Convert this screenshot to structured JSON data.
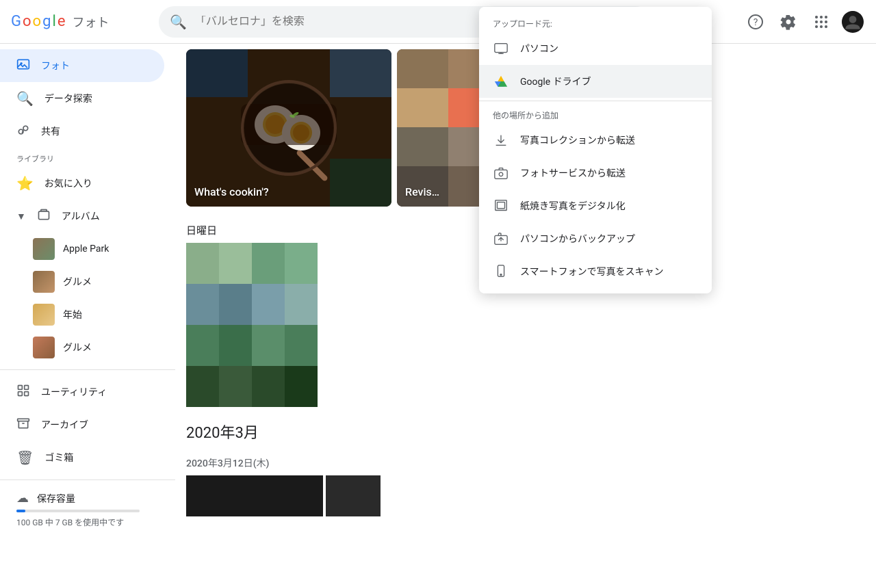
{
  "header": {
    "google_text": "Google",
    "app_name": "フォト",
    "search_placeholder": "「バルセロナ」を検索"
  },
  "sidebar": {
    "photos_label": "フォト",
    "search_label": "データ探索",
    "sharing_label": "共有",
    "library_section": "ライブラリ",
    "favorites_label": "お気に入り",
    "albums_label": "アルバム",
    "albums": [
      {
        "name": "Apple Park",
        "color1": "#8B7355",
        "color2": "#6B8E6B"
      },
      {
        "name": "グルメ",
        "color1": "#8B6B47",
        "color2": "#C4956A"
      },
      {
        "name": "年始",
        "color1": "#D4A853",
        "color2": "#E8C88A"
      },
      {
        "name": "グルメ",
        "color1": "#C47A5A",
        "color2": "#8B5E3C"
      }
    ],
    "utilities_label": "ユーティリティ",
    "archive_label": "アーカイブ",
    "trash_label": "ゴミ箱",
    "storage_label": "保存容量",
    "storage_info": "100 GB 中 7 GB を使用中です",
    "storage_percent": 7
  },
  "dropdown": {
    "upload_section_label": "アップロード元:",
    "items_upload": [
      {
        "id": "pc",
        "label": "パソコン",
        "icon": "💻"
      },
      {
        "id": "google-drive",
        "label": "Google ドライブ",
        "icon": "▲",
        "highlighted": true
      }
    ],
    "other_section_label": "他の場所から追加",
    "items_other": [
      {
        "id": "photo-collection",
        "label": "写真コレクションから転送",
        "icon": "⬇"
      },
      {
        "id": "photo-service",
        "label": "フォトサービスから転送",
        "icon": "📷"
      },
      {
        "id": "print-digitize",
        "label": "紙焼き写真をデジタル化",
        "icon": "🖼"
      },
      {
        "id": "pc-backup",
        "label": "パソコンからバックアップ",
        "icon": "⬆"
      },
      {
        "id": "smartphone-scan",
        "label": "スマートフォンで写真をスキャン",
        "icon": "📱"
      }
    ]
  },
  "content": {
    "sunday_label": "日曜日",
    "march_2020_label": "2020年3月",
    "march_12_label": "2020年3月12日(木)"
  }
}
